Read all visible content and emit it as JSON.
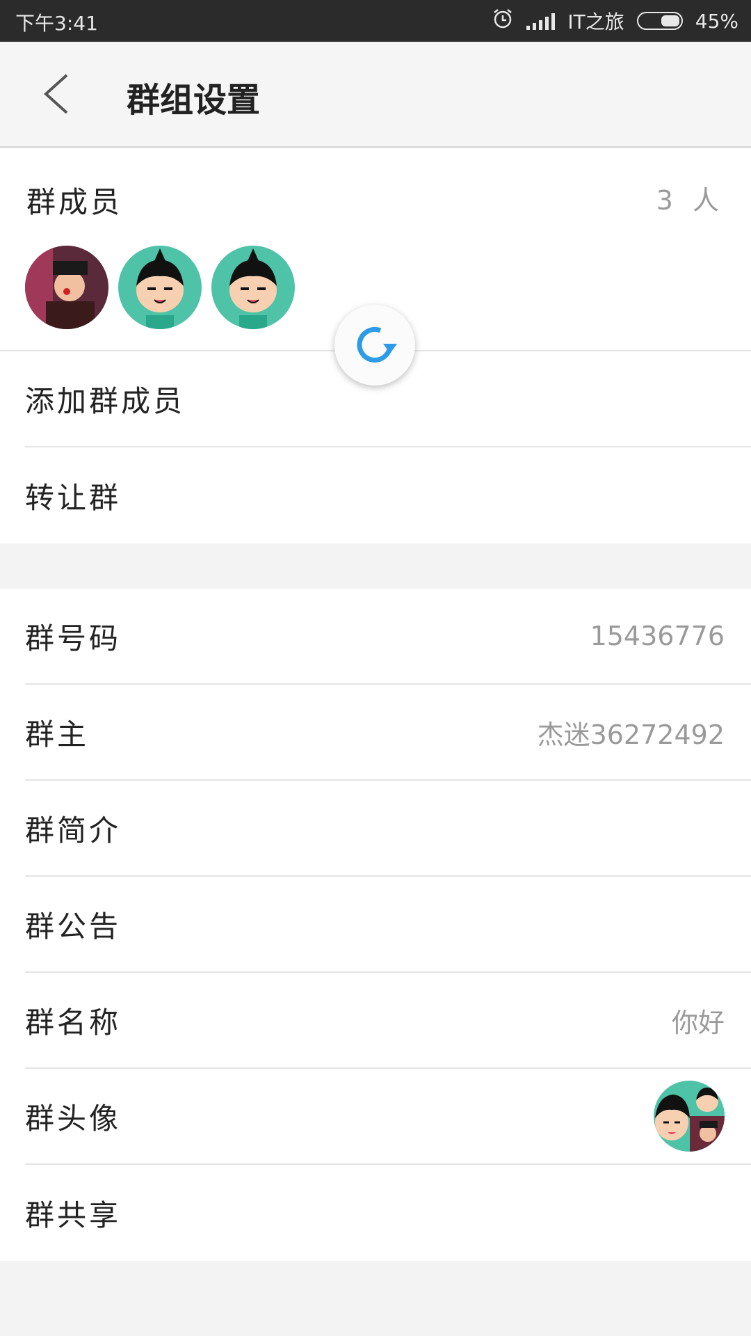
{
  "status_bar": {
    "time": "下午3:41",
    "carrier": "IT之旅",
    "battery": "45%",
    "icons": [
      "alarm-icon",
      "signal-icon",
      "battery-icon"
    ]
  },
  "header": {
    "back_icon": "chevron-left-icon",
    "title": "群组设置"
  },
  "members": {
    "label": "群成员",
    "count": "3 人",
    "avatars": [
      "photo-avatar",
      "cartoon-boy-avatar",
      "cartoon-boy-avatar"
    ]
  },
  "refresh_icon": "refresh-icon",
  "section1": {
    "add_member": "添加群成员",
    "transfer": "转让群"
  },
  "section2": {
    "number_label": "群号码",
    "number_value": "15436776",
    "owner_label": "群主",
    "owner_value": "杰迷36272492",
    "intro_label": "群简介",
    "notice_label": "群公告",
    "name_label": "群名称",
    "name_value": "你好",
    "avatar_label": "群头像",
    "share_label": "群共享"
  },
  "colors": {
    "accent": "#2e9be8",
    "avatar_bg": "#4fc3a8",
    "status_bar": "#2b2b2b"
  }
}
